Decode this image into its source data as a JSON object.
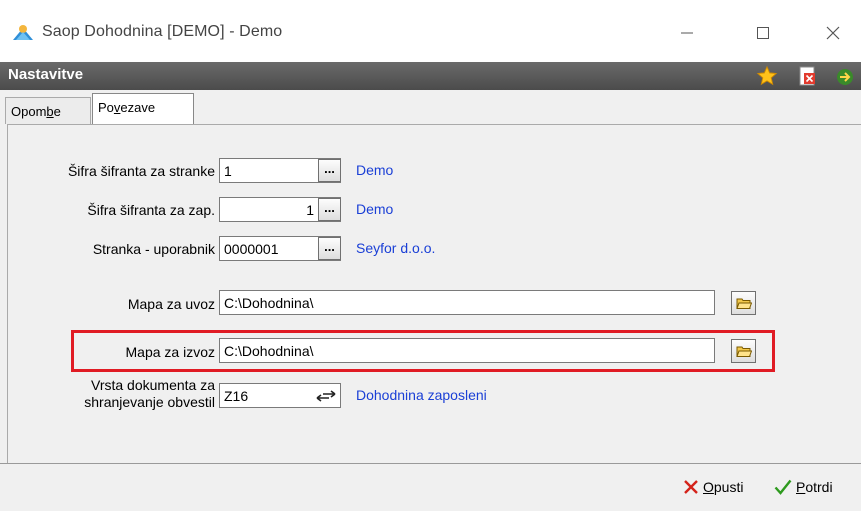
{
  "window": {
    "title": "Saop Dohodnina [DEMO] - Demo",
    "controls": [
      "minimize",
      "maximize",
      "close"
    ]
  },
  "header": {
    "title": "Nastavitve",
    "icons": [
      "star-icon",
      "document-close-icon",
      "exit-icon"
    ]
  },
  "tabs": [
    {
      "label": "Opombe",
      "underline": "b",
      "active": false
    },
    {
      "label": "Povezave",
      "underline": "v",
      "active": true
    }
  ],
  "form": {
    "sifrant_stranke": {
      "label": "Šifra šifranta za stranke",
      "value": "1",
      "link": "Demo"
    },
    "sifrant_zap": {
      "label": "Šifra šifranta za zap.",
      "value": "1",
      "link": "Demo"
    },
    "stranka_uporabnik": {
      "label": "Stranka - uporabnik",
      "value": "0000001",
      "link": "Seyfor d.o.o."
    },
    "mapa_uvoz": {
      "label": "Mapa za uvoz",
      "value": "C:\\Dohodnina\\"
    },
    "mapa_izvoz": {
      "label": "Mapa za izvoz",
      "value": "C:\\Dohodnina\\"
    },
    "vrsta_dokumenta": {
      "label_line1": "Vrsta dokumenta za",
      "label_line2": "shranjevanje obvestil",
      "value": "Z16",
      "link": "Dohodnina zaposleni"
    }
  },
  "footer": {
    "cancel_label": "Opusti",
    "ok_label": "Potrdi"
  },
  "colors": {
    "link": "#1a3fd6",
    "header_bg": "#555555",
    "highlight": "#e01b24"
  }
}
